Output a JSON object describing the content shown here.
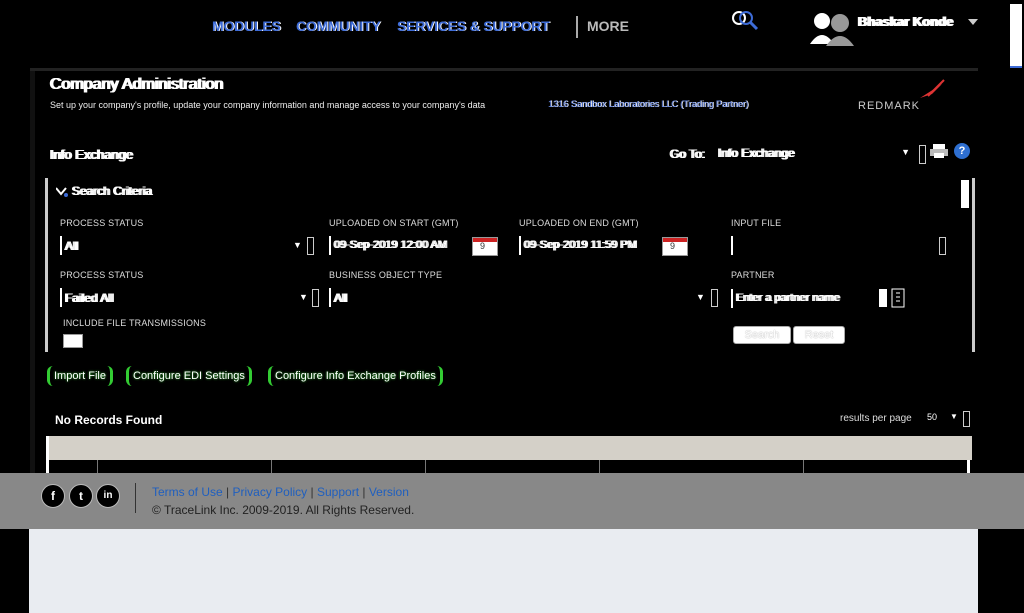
{
  "nav": {
    "items": [
      "MODULES",
      "COMMUNITY",
      "SERVICES & SUPPORT"
    ],
    "more": "MORE",
    "user_name": "Bhaskar Konde"
  },
  "page": {
    "title": "Company Administration",
    "subtitle": "Set up your company's profile, update your company information and manage access to your company's data",
    "org_link": "1316 Sandbox Laboratories LLC (Trading Partner)",
    "logo_text": "REDMARK"
  },
  "section": {
    "title": "Info Exchange",
    "goto_label": "Go To:",
    "goto_value": "Info Exchange"
  },
  "criteria": {
    "title": "Search Criteria",
    "fields": {
      "process_status_label": "PROCESS STATUS",
      "process_status_value": "All",
      "uploaded_start_label": "UPLOADED ON START (GMT)",
      "uploaded_start_value": "09-Sep-2019 12:00 AM",
      "uploaded_end_label": "UPLOADED ON END (GMT)",
      "uploaded_end_value": "09-Sep-2019 11:59 PM",
      "input_file_label": "INPUT FILE",
      "input_file_value": "",
      "error_status_label": "PROCESS STATUS",
      "error_status_value": "Failed All",
      "business_type_label": "BUSINESS OBJECT TYPE",
      "business_type_value": "All",
      "partner_label": "PARTNER",
      "partner_placeholder": "Enter a partner name",
      "include_label": "INCLUDE FILE TRANSMISSIONS",
      "calendar_day": "9"
    },
    "search_label": "Search",
    "reset_label": "Reset"
  },
  "actions": {
    "import": "Import File",
    "configure_edi": "Configure EDI Settings",
    "configure_profiles": "Configure Info Exchange Profiles"
  },
  "results": {
    "empty": "No Records Found",
    "rpp_label": "results per page",
    "rpp_value": "50"
  },
  "footer": {
    "terms": "Terms of Use",
    "privacy": "Privacy Policy",
    "support": "Support",
    "version": "Version",
    "separator": "|",
    "copyright": "© TraceLink Inc. 2009-2019. All Rights Reserved.",
    "social": [
      "f",
      "t",
      "in"
    ]
  },
  "colors": {
    "link_blue": "#3d6bd6",
    "action_green": "#33cc33",
    "footer_gray": "#888888"
  }
}
